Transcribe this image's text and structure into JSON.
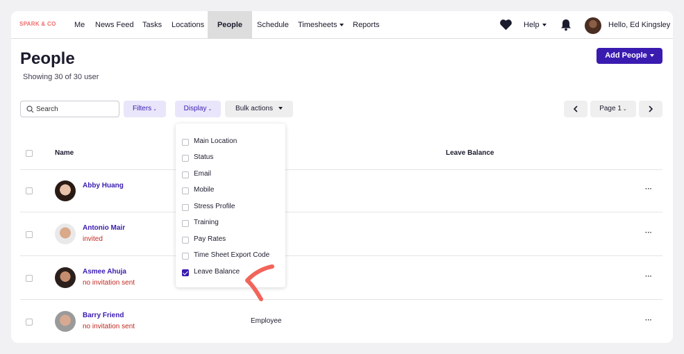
{
  "nav": {
    "logo": "SPARK & CO",
    "items": [
      "Me",
      "News Feed",
      "Tasks",
      "Locations",
      "People",
      "Schedule",
      "Timesheets",
      "Reports"
    ],
    "help": "Help",
    "greeting": "Hello, Ed Kingsley"
  },
  "header": {
    "title": "People",
    "subtitle": "Showing 30 of 30 user",
    "add_button": "Add People"
  },
  "toolbar": {
    "search_placeholder": "Search",
    "filters": "Filters",
    "display": "Display",
    "bulk": "Bulk actions",
    "page": "Page 1"
  },
  "table": {
    "columns": {
      "name": "Name",
      "leave": "Leave Balance"
    },
    "rows": [
      {
        "name": "Abby Huang",
        "status": "",
        "role": ""
      },
      {
        "name": "Antonio Mair",
        "status": "invited",
        "role": ""
      },
      {
        "name": "Asmee Ahuja",
        "status": "no invitation sent",
        "role": ""
      },
      {
        "name": "Barry Friend",
        "status": "no invitation sent",
        "role": "Employee"
      }
    ],
    "more": "···"
  },
  "display_menu": {
    "items": [
      {
        "label": "Main Location",
        "checked": false
      },
      {
        "label": "Status",
        "checked": false
      },
      {
        "label": "Email",
        "checked": false
      },
      {
        "label": "Mobile",
        "checked": false
      },
      {
        "label": "Stress Profile",
        "checked": false
      },
      {
        "label": "Training",
        "checked": false
      },
      {
        "label": "Pay Rates",
        "checked": false
      },
      {
        "label": "Time Sheet Export Code",
        "checked": false
      },
      {
        "label": "Leave Balance",
        "checked": true
      }
    ]
  },
  "colors": {
    "accent": "#3a1bb0",
    "logo": "#f26a6a",
    "warning": "#c0281f",
    "annotation": "#f2645a"
  }
}
